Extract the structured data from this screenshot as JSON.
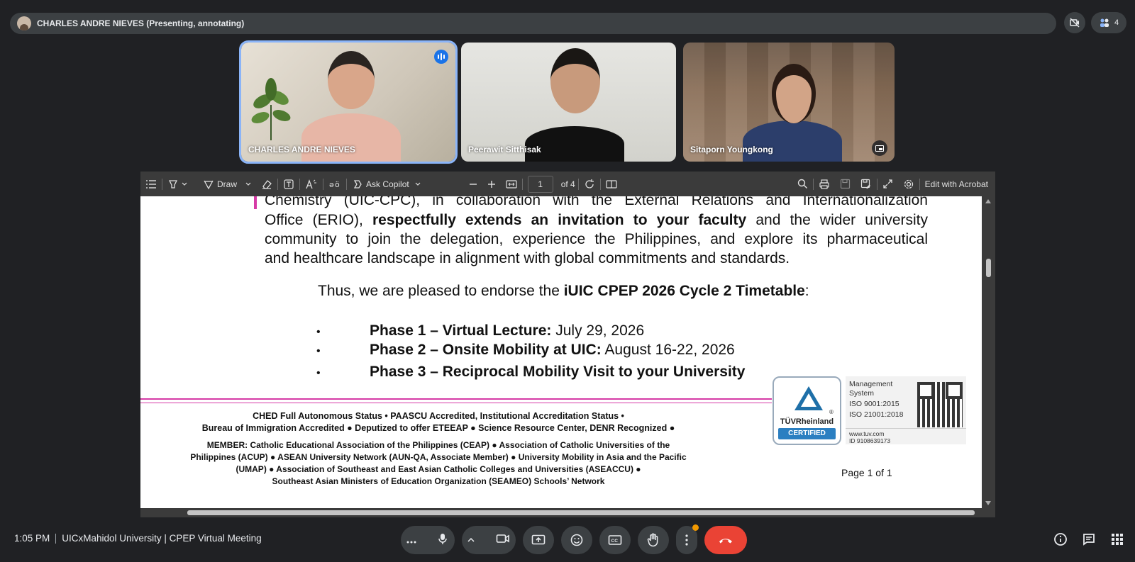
{
  "presenter": {
    "name": "CHARLES ANDRE NIEVES (Presenting, annotating)"
  },
  "top_right": {
    "participants_count": "4"
  },
  "tiles": [
    {
      "name": "CHARLES ANDRE NIEVES"
    },
    {
      "name": "Peerawit Sitthisak"
    },
    {
      "name": "Sitaporn Youngkong"
    }
  ],
  "toolbar": {
    "draw_label": "Draw",
    "copilot_label": "Ask Copilot",
    "page_number": "1",
    "page_total": "of 4",
    "edit_label": "Edit with Acrobat"
  },
  "document": {
    "para_line1": "Chemistry (UIC-CPC), in collaboration with the External Relations and Internationalization",
    "para_line2_pre": "Office (ERIO), ",
    "para_line2_bold": "respectfully extends an invitation to your faculty",
    "para_line2_post": " and the wider university",
    "para_line3": "community to join the delegation, experience the Philippines, and explore its pharmaceutical",
    "para_line4": "and healthcare landscape in alignment with global commitments and standards.",
    "endorse_pre": "Thus, we are pleased to endorse the ",
    "endorse_bold": "iUIC CPEP 2026 Cycle 2 Timetable",
    "endorse_post": ":",
    "bullet": "•",
    "phases": [
      {
        "title": "Phase 1 – Virtual Lecture:",
        "date": " July 29, 2026"
      },
      {
        "title": "Phase 2 – Onsite Mobility at UIC:",
        "date": " August 16-22, 2026"
      },
      {
        "title": "Phase 3 – Reciprocal Mobility Visit to your University",
        "date": ""
      }
    ],
    "footer": [
      "CHED Full Autonomous Status • PAASCU Accredited, Institutional Accreditation Status •",
      "Bureau of Immigration Accredited ● Deputized to offer ETEEAP ● Science Resource Center, DENR Recognized ●",
      "MEMBER: Catholic Educational Association of the Philippines (CEAP) ● Association of Catholic Universities of the",
      "Philippines (ACUP) ● ASEAN University Network (AUN-QA, Associate Member) ● University Mobility in Asia and the Pacific",
      "(UMAP) ● Association of Southeast and East Asian Catholic Colleges and Universities (ASEACCU) ●",
      "Southeast Asian Ministers of Education Organization (SEAMEO) Schools’ Network"
    ],
    "tuv_name": "TÜVRheinland",
    "tuv_registered": "®",
    "tuv_certified": "CERTIFIED",
    "mgmt_system_1": "Management",
    "mgmt_system_2": "System",
    "iso_1": "ISO 9001:2015",
    "iso_2": "ISO 21001:2018",
    "tuv_site": "www.tuv.com",
    "tuv_id": "ID 9108639173",
    "page_of": "Page 1 of 1"
  },
  "bottom": {
    "time": "1:05 PM",
    "meeting_title": "UICxMahidol University | CPEP Virtual Meeting"
  },
  "colors": {
    "accent": "#8ab4f8",
    "end_call": "#ea4335",
    "annotation_pink": "#d63aa6"
  }
}
